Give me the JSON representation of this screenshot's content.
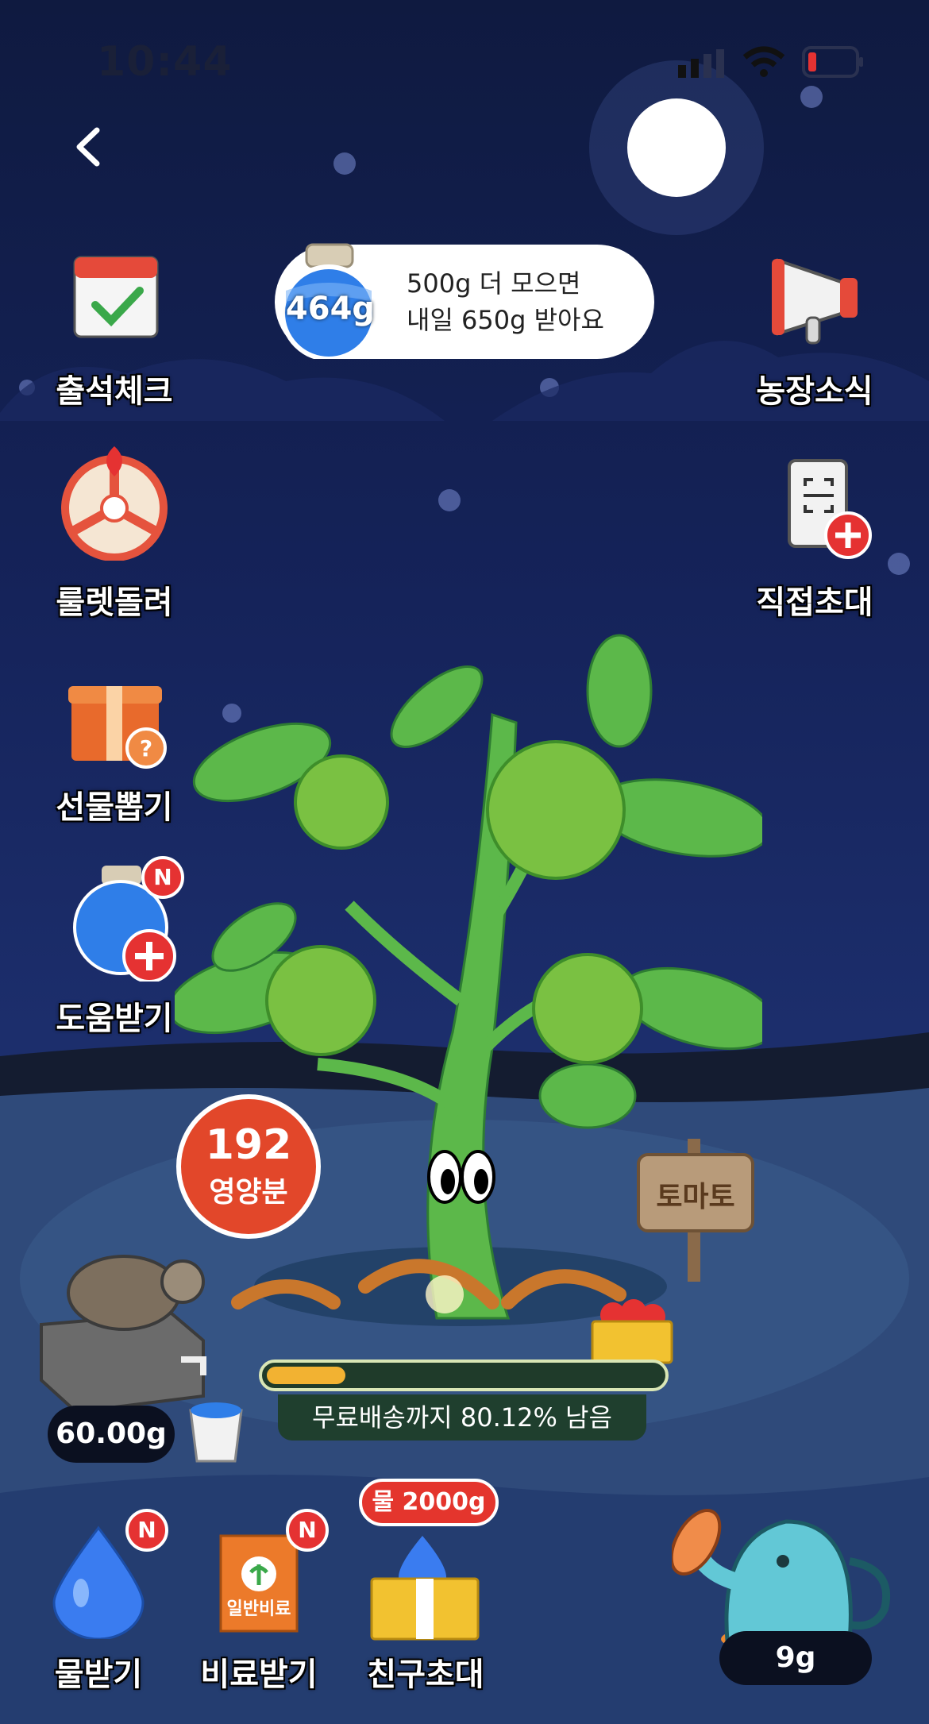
{
  "status_bar": {
    "time": "10:44"
  },
  "nav": {
    "back_icon": "chevron-left-icon"
  },
  "water_jar": {
    "amount": "464g",
    "message_line1": "500g 더 모으면",
    "message_line2": "내일 650g 받아요"
  },
  "left_menu": [
    {
      "label": "출석체크",
      "icon": "calendar-check-icon"
    },
    {
      "label": "룰렛돌려",
      "icon": "roulette-icon"
    },
    {
      "label": "선물뽑기",
      "icon": "gift-box-icon"
    },
    {
      "label": "도움받기",
      "icon": "water-jar-plus-icon",
      "badge": "N"
    }
  ],
  "right_menu": [
    {
      "label": "농장소식",
      "icon": "megaphone-icon"
    },
    {
      "label": "직접초대",
      "icon": "qr-invite-icon"
    }
  ],
  "nutrient": {
    "value": "192",
    "label": "영양분"
  },
  "sign": {
    "label": "토마토"
  },
  "watering": {
    "amount": "60.00g"
  },
  "progress": {
    "fraction": 0.1988,
    "caption": "무료배송까지 80.12% 남음"
  },
  "bottom_menu": [
    {
      "label": "물받기",
      "icon": "water-drop-icon",
      "badge": "N"
    },
    {
      "label": "비료받기",
      "icon": "fertilizer-bag-icon",
      "badge": "N",
      "bag_text": "일반비료"
    },
    {
      "label": "친구초대",
      "icon": "invite-box-icon",
      "tag": "물 2000g"
    }
  ],
  "watering_can": {
    "amount": "9g"
  },
  "colors": {
    "sky": "#15235a",
    "accent": "#e53232",
    "progress": "#f2b232",
    "plant": "#5cb84a"
  }
}
